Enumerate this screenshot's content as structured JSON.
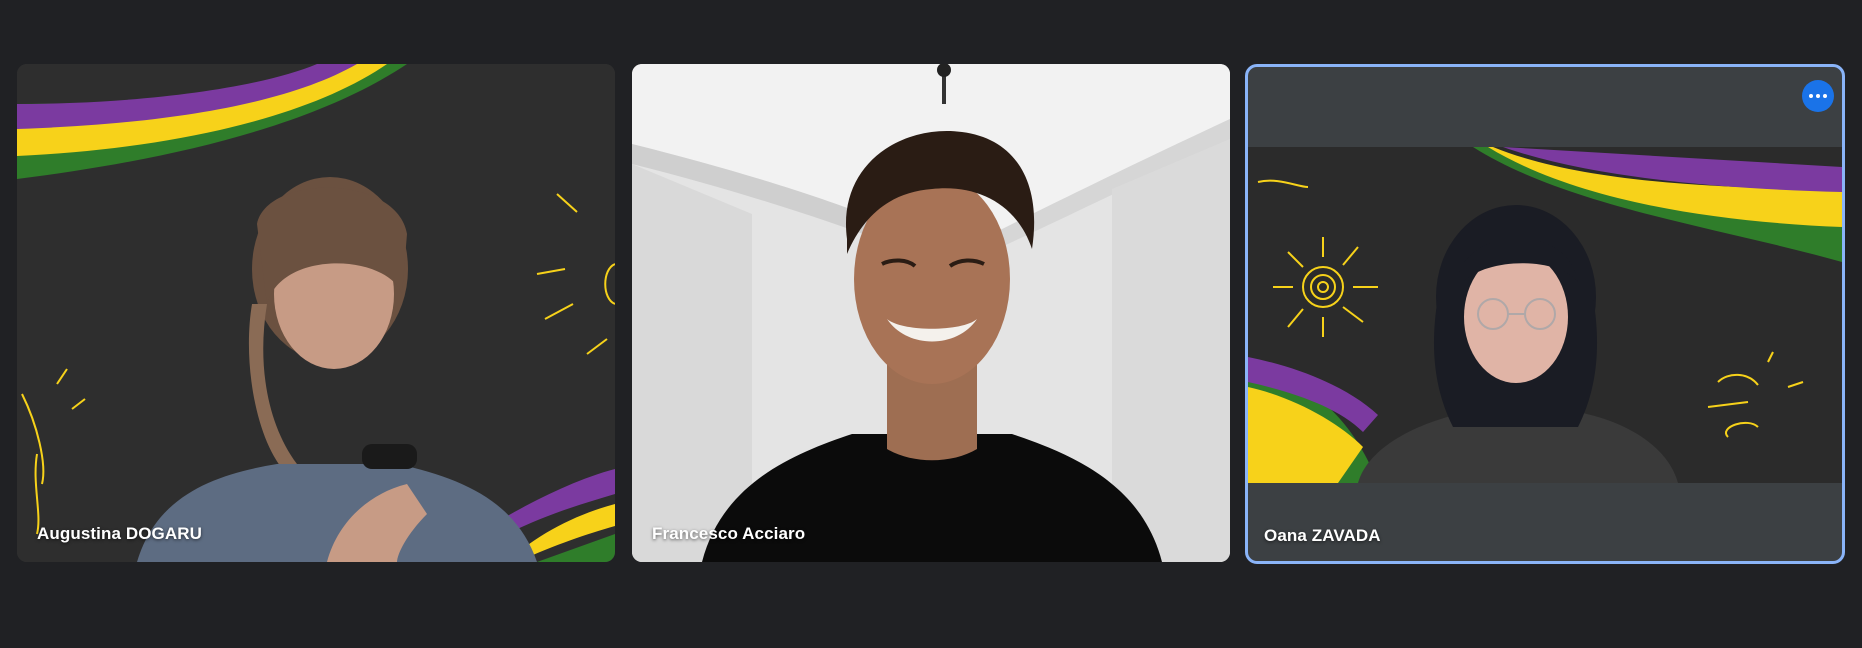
{
  "participants": [
    {
      "name": "Augustina DOGARU",
      "active_speaker": false
    },
    {
      "name": "Francesco Acciaro",
      "active_speaker": false
    },
    {
      "name": "Oana ZAVADA",
      "active_speaker": true
    }
  ],
  "controls": {
    "more_options_icon": "more-horizontal-icon"
  },
  "colors": {
    "background": "#202124",
    "tile_background": "#3c4043",
    "active_border": "#8ab4f8",
    "accent": "#1a73e8",
    "stripe_purple": "#7b3aa0",
    "stripe_yellow": "#f7d21a",
    "stripe_green": "#2f7d2a"
  }
}
